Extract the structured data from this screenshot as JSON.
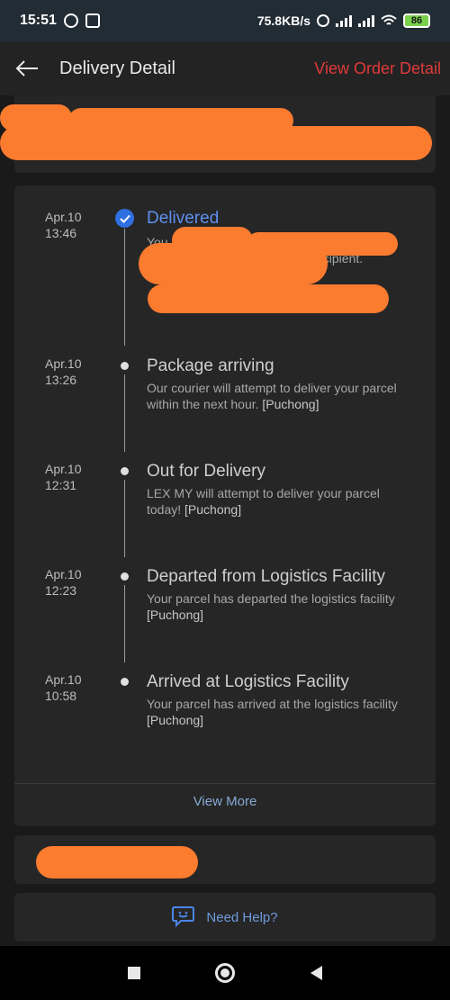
{
  "status_bar": {
    "time": "15:51",
    "speed": "75.8KB/s",
    "battery": "86"
  },
  "header": {
    "title": "Delivery Detail",
    "order_link": "View Order Detail"
  },
  "timeline": [
    {
      "date": "Apr.10",
      "time": "13:46",
      "title": "Delivered",
      "desc_visible": "You",
      "desc_fragment": "ecipient.",
      "status": "completed"
    },
    {
      "date": "Apr.10",
      "time": "13:26",
      "title": "Package arriving",
      "desc": "Our courier will attempt to deliver your parcel within the next hour.",
      "location": "[Puchong]"
    },
    {
      "date": "Apr.10",
      "time": "12:31",
      "title": "Out for Delivery",
      "desc": "LEX MY will attempt to deliver your parcel today!",
      "location": "[Puchong]"
    },
    {
      "date": "Apr.10",
      "time": "12:23",
      "title": "Departed from Logistics Facility",
      "desc": "Your parcel has departed the logistics facility",
      "location": "[Puchong]"
    },
    {
      "date": "Apr.10",
      "time": "10:58",
      "title": "Arrived at Logistics Facility",
      "desc": "Your parcel has arrived at the logistics facility",
      "location": "[Puchong]"
    }
  ],
  "view_more": "View More",
  "help": {
    "label": "Need Help?"
  },
  "colors": {
    "accent_blue": "#5e8ff0",
    "order_red": "#e03a3a",
    "redaction": "#fb7b2f"
  }
}
